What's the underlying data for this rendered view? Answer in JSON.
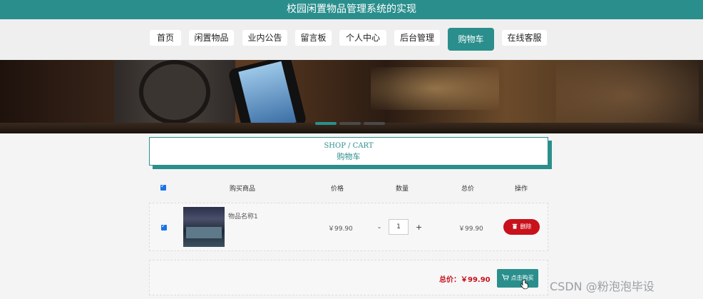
{
  "header": {
    "title": "校园闲置物品管理系统的实现"
  },
  "nav": {
    "items": [
      "首页",
      "闲置物品",
      "业内公告",
      "留言板",
      "个人中心",
      "后台管理",
      "购物车",
      "在线客服"
    ],
    "active": "购物车"
  },
  "section": {
    "title_en": "SHOP / CART",
    "title_cn": "购物车"
  },
  "cart": {
    "columns": {
      "product": "购买商品",
      "price": "价格",
      "quantity": "数量",
      "total": "总价",
      "action": "操作"
    },
    "items": [
      {
        "name": "物品名称1",
        "price": "￥99.90",
        "quantity": "1",
        "total": "￥99.90",
        "delete_label": "删除"
      }
    ],
    "minus": "-",
    "plus": "+",
    "summary": {
      "total_text": "总价：￥99.90",
      "buy_label": "点击购买"
    }
  },
  "watermark": "CSDN @粉泡泡毕设",
  "colors": {
    "accent": "#2a8f8c",
    "danger": "#c8111b",
    "checkbox": "#1a73e8"
  },
  "icons": {
    "delete": "trash-icon",
    "buy": "cart-icon",
    "cursor": "hand-pointer-icon"
  }
}
